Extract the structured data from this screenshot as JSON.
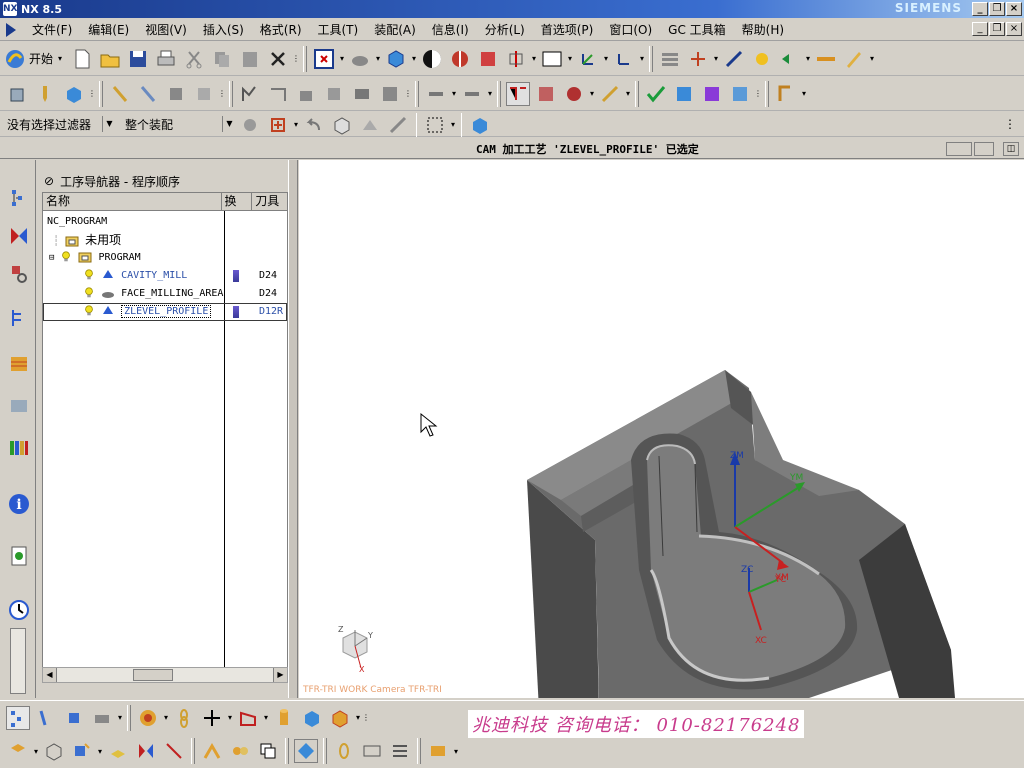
{
  "window": {
    "title": "NX 8.5",
    "brand": "SIEMENS",
    "min": "_",
    "max": "❐",
    "close": "×"
  },
  "menu": [
    "文件(F)",
    "编辑(E)",
    "视图(V)",
    "插入(S)",
    "格式(R)",
    "工具(T)",
    "装配(A)",
    "信息(I)",
    "分析(L)",
    "首选项(P)",
    "窗口(O)",
    "GC 工具箱",
    "帮助(H)"
  ],
  "toolbar1": {
    "start_label": "开始"
  },
  "filter": {
    "selection_filter": "没有选择过滤器",
    "assembly_scope": "整个装配"
  },
  "status": {
    "message": "CAM 加工工艺 'ZLEVEL_PROFILE' 已选定"
  },
  "navigator": {
    "title": "工序导航器 - 程序顺序",
    "columns": [
      "名称",
      "换",
      "刀具"
    ],
    "rows": [
      {
        "name": "NC_PROGRAM",
        "tool": ""
      },
      {
        "name": "未用项",
        "tool": ""
      },
      {
        "name": "PROGRAM",
        "tool": ""
      },
      {
        "name": "CAVITY_MILL",
        "tool": "D24"
      },
      {
        "name": "FACE_MILLING_AREA",
        "tool": "D24"
      },
      {
        "name": "ZLEVEL_PROFILE",
        "tool": "D12R"
      }
    ]
  },
  "viewport": {
    "camera_label": "TFR-TRI WORK Camera TFR-TRI",
    "axes": {
      "zm": "ZM",
      "ym": "YM",
      "xm": "XM",
      "zc": "ZC",
      "yc": "YC",
      "xc": "XC",
      "z": "Z",
      "y": "Y",
      "x": "X"
    }
  },
  "watermark": "兆迪科技  咨询电话：  010-82176248",
  "colors": {
    "title_gradient_start": "#1a3a8c",
    "watermark_text": "#c83b8c",
    "tree_text_blue": "#2b4fa8"
  }
}
